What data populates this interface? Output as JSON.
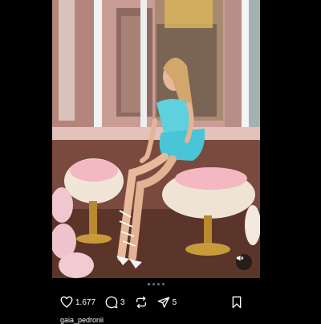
{
  "post": {
    "likes": "1.677",
    "comments": "3",
    "shares": "5",
    "username": "gaia_pedronii",
    "carousel_pages": 4,
    "carousel_active_index": 0
  },
  "icons": {
    "like": "heart-icon",
    "comment": "comment-bubble-icon",
    "repost": "repost-icon",
    "share": "send-icon",
    "save": "bookmark-icon",
    "sound": "speaker-muted-icon"
  },
  "colors": {
    "background": "#000000",
    "carousel_active": "#3897f0",
    "carousel_inactive": "#6b6b6b",
    "text": "#ffffff"
  }
}
